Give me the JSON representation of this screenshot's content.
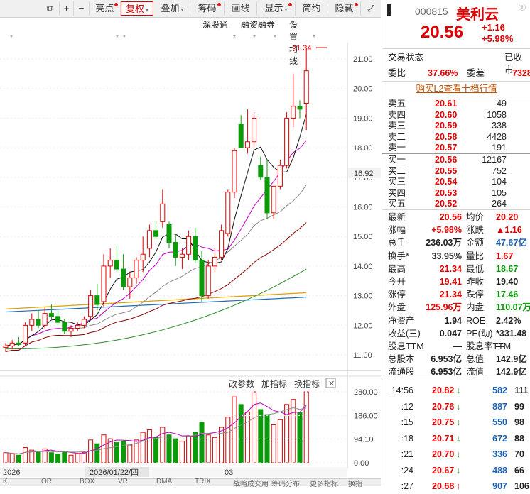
{
  "toolbar": {
    "items": [
      {
        "label": "亮点",
        "dot": true
      },
      {
        "label": "复权",
        "caret": true,
        "active": true
      },
      {
        "label": "叠加",
        "caret": true
      },
      {
        "label": "筹码",
        "dot": true
      },
      {
        "label": "画线"
      },
      {
        "label": "显示",
        "caret": true,
        "dot": true
      },
      {
        "label": "简约"
      },
      {
        "label": "隐藏",
        "dot": true
      }
    ],
    "links": [
      "深股通",
      "融资融券",
      "设置均线"
    ]
  },
  "chart": {
    "price_ticks": [
      "21.00",
      "20.00",
      "19.00",
      "18.00",
      "17.00",
      "16.00",
      "15.00",
      "14.00",
      "13.00",
      "12.00",
      "11.00"
    ],
    "current_price_label": "16.92",
    "high_marker": "21.34",
    "volume_ticks": [
      "280.00",
      "186.00",
      "94.10",
      "0.00"
    ],
    "volume_menu": [
      "改参数",
      "加指标",
      "换指标"
    ],
    "date_labels": [
      "2026",
      "2026/01/22/四",
      "03"
    ],
    "bottom_tabs": [
      "K",
      "OR",
      "BOX",
      "VR",
      "DMA",
      "TRIX",
      "战略成交用",
      "筹码分布",
      "更多指标",
      "换指"
    ]
  },
  "chart_data": {
    "type": "candlestick",
    "ylim": [
      10.6,
      21.5
    ],
    "candles": [
      [
        11.25,
        11.4,
        11.1,
        11.3
      ],
      [
        11.3,
        11.5,
        11.2,
        11.4
      ],
      [
        11.4,
        11.6,
        11.3,
        11.35
      ],
      [
        11.4,
        12.1,
        11.3,
        12.0
      ],
      [
        12.0,
        12.4,
        11.8,
        12.2
      ],
      [
        12.2,
        12.5,
        11.9,
        12.0
      ],
      [
        12.0,
        12.6,
        11.9,
        12.4
      ],
      [
        12.4,
        12.7,
        12.2,
        12.3
      ],
      [
        12.3,
        12.5,
        12.0,
        12.1
      ],
      [
        12.1,
        12.2,
        11.7,
        11.8
      ],
      [
        11.8,
        12.0,
        11.6,
        11.9
      ],
      [
        11.9,
        12.1,
        11.8,
        12.0
      ],
      [
        12.0,
        12.3,
        11.9,
        12.2
      ],
      [
        12.3,
        13.2,
        12.2,
        13.0
      ],
      [
        13.0,
        13.4,
        12.5,
        12.7
      ],
      [
        12.8,
        14.4,
        12.6,
        14.0
      ],
      [
        14.0,
        14.6,
        13.6,
        14.2
      ],
      [
        14.2,
        14.7,
        13.8,
        13.9
      ],
      [
        13.9,
        14.4,
        13.2,
        13.3
      ],
      [
        13.3,
        13.8,
        12.9,
        13.6
      ],
      [
        13.6,
        14.3,
        13.4,
        14.2
      ],
      [
        14.2,
        15.0,
        13.8,
        14.4
      ],
      [
        14.6,
        15.4,
        14.3,
        15.2
      ],
      [
        15.2,
        15.5,
        14.9,
        15.0
      ],
      [
        15.5,
        16.6,
        15.3,
        16.1
      ],
      [
        15.4,
        15.5,
        14.6,
        14.8
      ],
      [
        14.8,
        15.1,
        14.0,
        14.3
      ],
      [
        14.3,
        14.6,
        13.9,
        14.4
      ],
      [
        14.4,
        15.2,
        14.2,
        15.0
      ],
      [
        15.0,
        15.3,
        14.1,
        14.2
      ],
      [
        14.2,
        14.5,
        12.8,
        13.0
      ],
      [
        13.0,
        14.2,
        12.9,
        14.0
      ],
      [
        14.0,
        14.6,
        13.8,
        14.3
      ],
      [
        14.3,
        15.4,
        14.2,
        15.2
      ],
      [
        15.1,
        16.6,
        15.0,
        16.5
      ],
      [
        16.5,
        18.0,
        16.3,
        17.9
      ],
      [
        18.8,
        19.1,
        18.0,
        18.0
      ],
      [
        18.0,
        19.3,
        17.8,
        18.2
      ],
      [
        18.2,
        19.2,
        18.0,
        19.0
      ],
      [
        17.4,
        17.7,
        16.9,
        17.0
      ],
      [
        17.0,
        17.6,
        15.6,
        15.8
      ],
      [
        15.8,
        16.7,
        15.6,
        16.7
      ],
      [
        16.7,
        17.6,
        16.6,
        17.4
      ],
      [
        17.4,
        19.2,
        17.3,
        19.0
      ],
      [
        19.0,
        20.5,
        18.7,
        19.4
      ],
      [
        19.4,
        19.6,
        19.0,
        19.3
      ],
      [
        19.5,
        21.34,
        18.6,
        20.6
      ]
    ],
    "volumes": [
      40,
      35,
      30,
      60,
      50,
      45,
      55,
      40,
      35,
      45,
      30,
      35,
      40,
      90,
      75,
      110,
      95,
      80,
      85,
      70,
      90,
      120,
      130,
      100,
      140,
      110,
      95,
      85,
      105,
      120,
      160,
      110,
      100,
      140,
      180,
      260,
      230,
      200,
      280,
      210,
      190,
      150,
      170,
      230,
      250,
      200,
      280
    ]
  },
  "quote": {
    "code": "000815",
    "name": "美利云",
    "price": "20.56",
    "change": "+1.16",
    "pct": "+5.98%",
    "status_label": "交易状态",
    "status": "已收市",
    "wb_label": "委比",
    "wb": "37.66%",
    "wc_label": "委差",
    "wc": "7328",
    "l2_link": "购买L2查看十档行情"
  },
  "asks": [
    {
      "label": "卖五",
      "price": "20.61",
      "vol": "49"
    },
    {
      "label": "卖四",
      "price": "20.60",
      "vol": "1058"
    },
    {
      "label": "卖三",
      "price": "20.59",
      "vol": "338"
    },
    {
      "label": "卖二",
      "price": "20.58",
      "vol": "4428"
    },
    {
      "label": "卖一",
      "price": "20.57",
      "vol": "191"
    }
  ],
  "bids": [
    {
      "label": "买一",
      "price": "20.56",
      "vol": "12167"
    },
    {
      "label": "买二",
      "price": "20.55",
      "vol": "752"
    },
    {
      "label": "买三",
      "price": "20.54",
      "vol": "104"
    },
    {
      "label": "买四",
      "price": "20.53",
      "vol": "105"
    },
    {
      "label": "买五",
      "price": "20.52",
      "vol": "264"
    }
  ],
  "stats": [
    {
      "l1": "最新",
      "v1": "20.56",
      "c1": "red",
      "l2": "均价",
      "v2": "20.20",
      "c2": "red"
    },
    {
      "l1": "涨幅",
      "v1": "+5.98%",
      "c1": "red",
      "l2": "涨跌",
      "v2": "▲1.16",
      "c2": "red"
    },
    {
      "l1": "总手",
      "v1": "236.03万",
      "c1": "",
      "l2": "金额",
      "v2": "47.67亿",
      "c2": "blue"
    },
    {
      "l1": "换手*",
      "v1": "33.95%",
      "c1": "",
      "l2": "量比",
      "v2": "1.67",
      "c2": "red"
    },
    {
      "l1": "最高",
      "v1": "21.34",
      "c1": "red",
      "l2": "最低",
      "v2": "18.67",
      "c2": "green"
    },
    {
      "l1": "今开",
      "v1": "19.41",
      "c1": "red",
      "l2": "昨收",
      "v2": "19.40",
      "c2": ""
    },
    {
      "l1": "涨停",
      "v1": "21.34",
      "c1": "red",
      "l2": "跌停",
      "v2": "17.46",
      "c2": "green"
    },
    {
      "l1": "外盘",
      "v1": "125.96万",
      "c1": "red",
      "l2": "内盘",
      "v2": "110.07万",
      "c2": "green"
    },
    {
      "l1": "净资产",
      "v1": "1.94",
      "c1": "",
      "l2": "ROE",
      "v2": "2.42%",
      "c2": ""
    },
    {
      "l1": "收益(三)",
      "v1": "0.047",
      "c1": "",
      "l2": "PE(动)",
      "v2": "*331.48",
      "c2": ""
    },
    {
      "l1": "股息TTM",
      "v1": "—",
      "c1": "",
      "l2": "股息率TTM",
      "v2": "—",
      "c2": ""
    },
    {
      "l1": "总股本",
      "v1": "6.953亿",
      "c1": "",
      "l2": "总值",
      "v2": "142.9亿",
      "c2": ""
    },
    {
      "l1": "流通股",
      "v1": "6.953亿",
      "c1": "",
      "l2": "流值",
      "v2": "142.9亿",
      "c2": ""
    }
  ],
  "ticks": [
    {
      "time": "14:56",
      "price": "20.82",
      "dir": "↓",
      "vol": "582",
      "num": "111"
    },
    {
      "time": ":12",
      "price": "20.76",
      "dir": "↓",
      "vol": "887",
      "num": "99"
    },
    {
      "time": ":15",
      "price": "20.75",
      "dir": "↓",
      "vol": "550",
      "num": "98"
    },
    {
      "time": ":18",
      "price": "20.71",
      "dir": "↓",
      "vol": "672",
      "num": "88"
    },
    {
      "time": ":21",
      "price": "20.70",
      "dir": "↓",
      "vol": "336",
      "num": "70"
    },
    {
      "time": ":24",
      "price": "20.67",
      "dir": "↓",
      "vol": "488",
      "num": "66"
    },
    {
      "time": ":27",
      "price": "20.68",
      "dir": "↑",
      "vol": "907",
      "num": "106"
    }
  ],
  "colors": {
    "up": "#e00000",
    "down": "#0a9a0a",
    "ma5": "#111111",
    "ma10": "#c000c0",
    "ma20": "#888888",
    "ma30": "#8b0000",
    "ma60": "#2e8b2e",
    "ma120": "#e0a000",
    "ma250": "#1e6fb4"
  }
}
